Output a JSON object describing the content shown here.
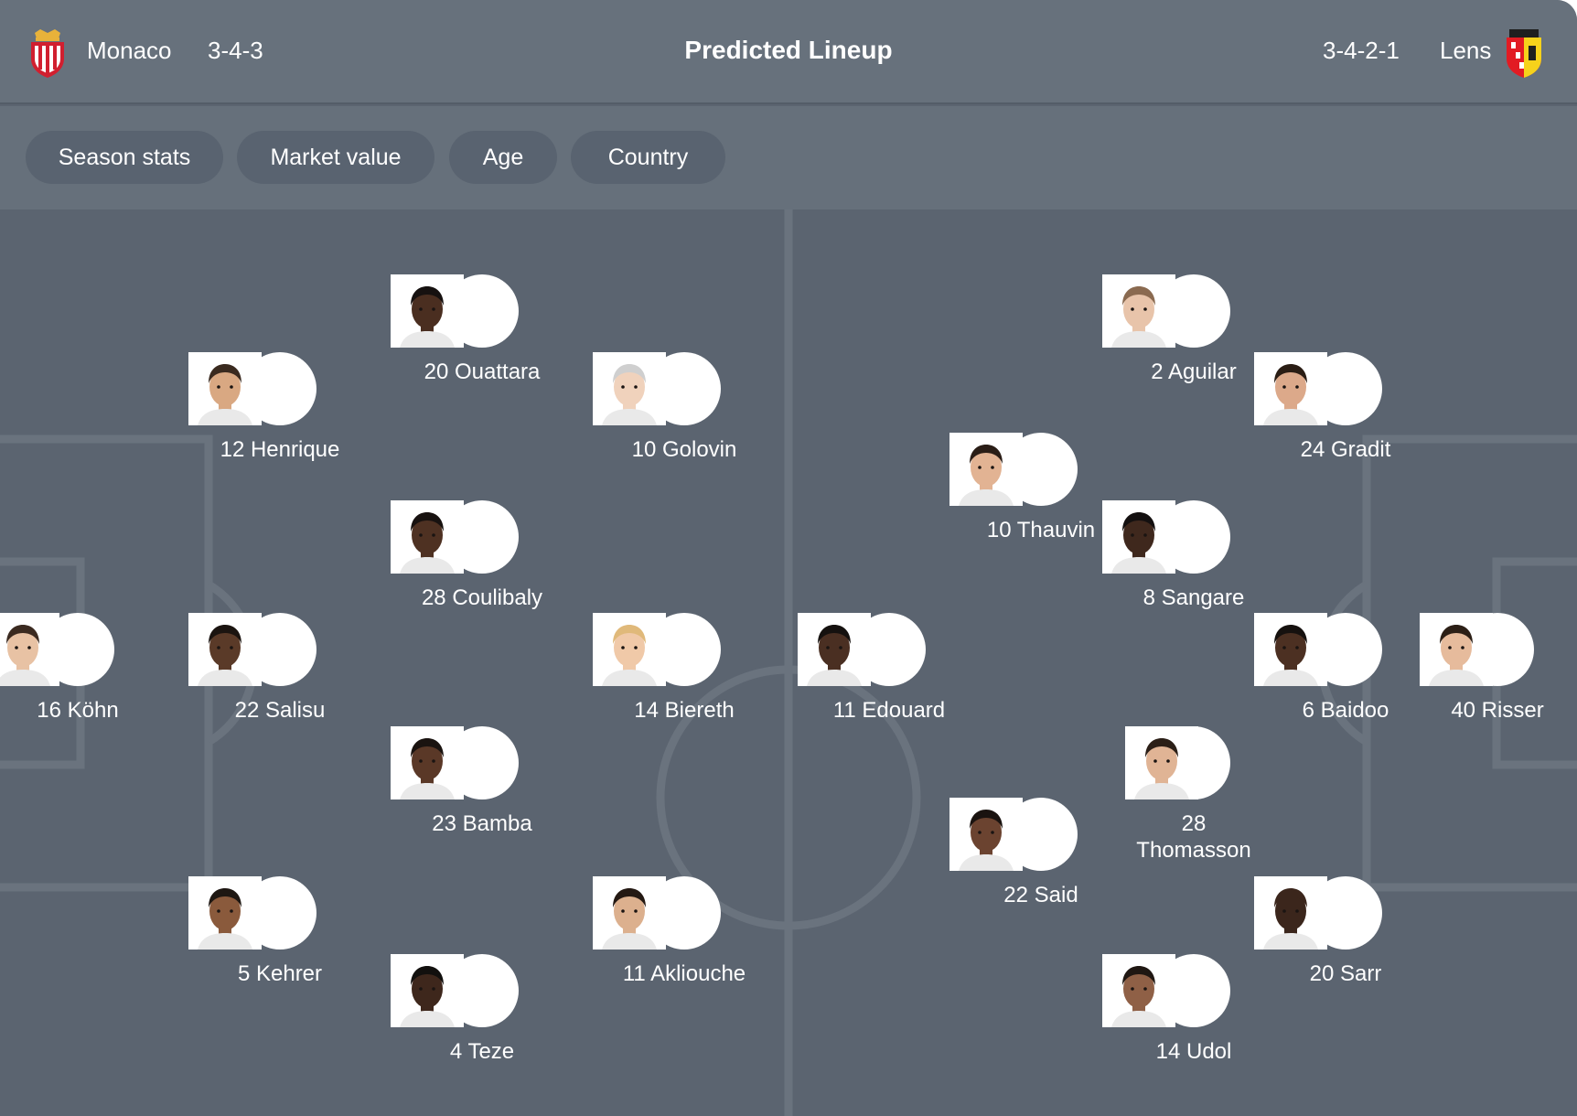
{
  "header": {
    "title": "Predicted Lineup",
    "home": {
      "name": "Monaco",
      "formation": "3-4-3",
      "crest_icon": "monaco-crest-icon",
      "crest_color": "#d11f2f"
    },
    "away": {
      "name": "Lens",
      "formation": "3-4-2-1",
      "crest_icon": "lens-crest-icon",
      "crest_color": "#e21b23"
    }
  },
  "filters": [
    "Season stats",
    "Market value",
    "Age",
    "Country"
  ],
  "colors": {
    "card": "#5b6470",
    "header": "#67717c",
    "chip": "#596370",
    "pitch_lines": "#6a737e"
  },
  "home_players": [
    {
      "label": "16 Köhn",
      "skin": "#e8c2a4",
      "hair": "#3b2a20"
    },
    {
      "label": "12 Henrique",
      "skin": "#d9a882",
      "hair": "#3a2a1f"
    },
    {
      "label": "22 Salisu",
      "skin": "#5a3a28",
      "hair": "#1b1410"
    },
    {
      "label": "5 Kehrer",
      "skin": "#8a5a3c",
      "hair": "#1e1712"
    },
    {
      "label": "20 Ouattara",
      "skin": "#4a2e20",
      "hair": "#161110"
    },
    {
      "label": "28 Coulibaly",
      "skin": "#4e3122",
      "hair": "#181210"
    },
    {
      "label": "23 Bamba",
      "skin": "#5a3827",
      "hair": "#1a1310"
    },
    {
      "label": "4 Teze",
      "skin": "#3e271c",
      "hair": "#12100e"
    },
    {
      "label": "10 Golovin",
      "skin": "#f0d2bc",
      "hair": "#cfcfcf"
    },
    {
      "label": "14 Biereth",
      "skin": "#f0c9a8",
      "hair": "#e0b97a"
    },
    {
      "label": "11 Akliouche",
      "skin": "#dcb08e",
      "hair": "#241913"
    }
  ],
  "away_players": [
    {
      "label": "11 Edouard",
      "skin": "#4a2f22",
      "hair": "#15110f"
    },
    {
      "label": "10 Thauvin",
      "skin": "#e2b393",
      "hair": "#2a1d16"
    },
    {
      "label": "22 Said",
      "skin": "#6b4330",
      "hair": "#1a1310"
    },
    {
      "label": "2 Aguilar",
      "skin": "#e8c4aa",
      "hair": "#8a6a50"
    },
    {
      "label": "8 Sangare",
      "skin": "#3f281d",
      "hair": "#141010"
    },
    {
      "label": "28 Thomasson",
      "skin": "#e0b495",
      "hair": "#2b1f17"
    },
    {
      "label": "14 Udol",
      "skin": "#8f6046",
      "hair": "#1f1712"
    },
    {
      "label": "24 Gradit",
      "skin": "#dca98a",
      "hair": "#2a1d14"
    },
    {
      "label": "6 Baidoo",
      "skin": "#4c3022",
      "hair": "#16110f"
    },
    {
      "label": "20 Sarr",
      "skin": "#3b261c",
      "hair": "#3b261c"
    },
    {
      "label": "40 Risser",
      "skin": "#e6bb9c",
      "hair": "#2c1f16"
    }
  ]
}
